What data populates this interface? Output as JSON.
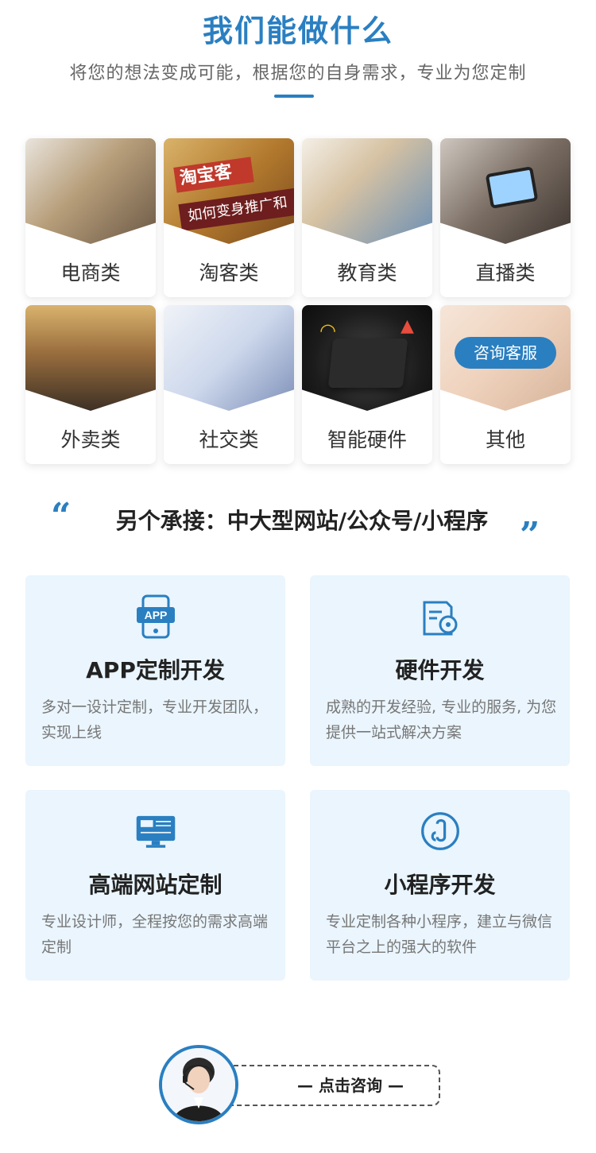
{
  "header": {
    "title": "我们能做什么",
    "subtitle": "将您的想法变成可能，根据您的自身需求，专业为您定制"
  },
  "categories": [
    {
      "label": "电商类"
    },
    {
      "label": "淘客类"
    },
    {
      "label": "教育类"
    },
    {
      "label": "直播类"
    },
    {
      "label": "外卖类"
    },
    {
      "label": "社交类"
    },
    {
      "label": "智能硬件"
    },
    {
      "label": "其他"
    }
  ],
  "image_text": {
    "taoke_line1": "淘宝客",
    "taoke_line2": "如何变身推广和",
    "consult_badge": "咨询客服"
  },
  "quote": {
    "open": "“",
    "text": "另个承接：中大型网站/公众号/小程序",
    "close": "”"
  },
  "services": [
    {
      "title": "APP定制开发",
      "desc": "多对一设计定制，专业开发团队，实现上线",
      "icon": "app-phone-icon"
    },
    {
      "title": "硬件开发",
      "desc": "成熟的开发经验, 专业的服务, 为您提供一站式解决方案",
      "icon": "hardware-gear-icon"
    },
    {
      "title": "高端网站定制",
      "desc": "专业设计师，全程按您的需求高端定制",
      "icon": "website-monitor-icon"
    },
    {
      "title": "小程序开发",
      "desc": "专业定制各种小程序，建立与微信平台之上的强大的软件",
      "icon": "mini-program-icon"
    }
  ],
  "consult": {
    "button_label": "— 点击咨询 —"
  },
  "colors": {
    "accent": "#2a7fc1",
    "card_bg": "#eaf5fd"
  }
}
